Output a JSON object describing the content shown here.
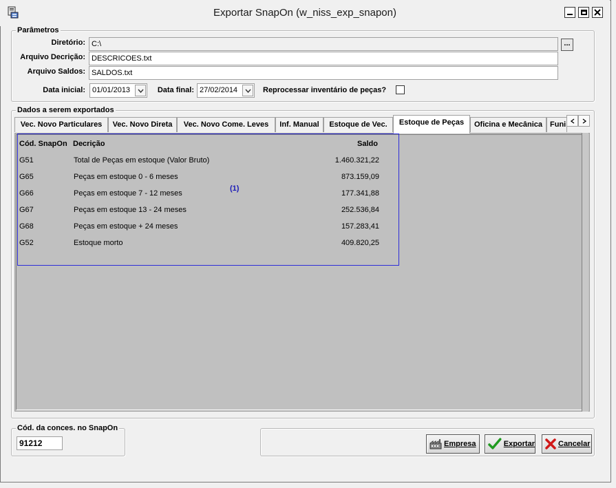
{
  "window": {
    "title": "Exportar SnapOn (w_niss_exp_snapon)"
  },
  "parametros": {
    "group_title": "Parâmetros",
    "diretorio_label": "Diretório:",
    "diretorio_value": "C:\\",
    "browse_label": "...",
    "arquivo_decricao_label": "Arquivo Decrição:",
    "arquivo_decricao_value": "DESCRICOES.txt",
    "arquivo_saldos_label": "Arquivo Saldos:",
    "arquivo_saldos_value": "SALDOS.txt",
    "data_inicial_label": "Data inicial:",
    "data_inicial_value": "01/01/2013",
    "data_final_label": "Data final:",
    "data_final_value": "27/02/2014",
    "reprocessar_label": "Reprocessar inventário de peças?",
    "reprocessar_checked": false
  },
  "dados": {
    "group_title": "Dados a serem exportados",
    "tabs": [
      {
        "label": "Vec. Novo Particulares",
        "active": false
      },
      {
        "label": "Vec. Novo Direta",
        "active": false
      },
      {
        "label": "Vec. Novo Come. Leves",
        "active": false
      },
      {
        "label": "Inf. Manual",
        "active": false
      },
      {
        "label": "Estoque de Vec.",
        "active": false
      },
      {
        "label": "Estoque de Peças",
        "active": true
      },
      {
        "label": "Oficina e Mecânica",
        "active": false
      },
      {
        "label": "Funi",
        "active": false
      }
    ],
    "report": {
      "columns": [
        "Cód. SnapOn",
        "Decrição",
        "Saldo"
      ],
      "marker": "(1)",
      "rows": [
        {
          "code": "G51",
          "desc": "Total de Peças em estoque (Valor Bruto)",
          "saldo": "1.460.321,22"
        },
        {
          "code": "G65",
          "desc": "Peças em estoque 0 - 6 meses",
          "saldo": "873.159,09"
        },
        {
          "code": "G66",
          "desc": "Peças em estoque 7 - 12 meses",
          "saldo": "177.341,88"
        },
        {
          "code": "G67",
          "desc": "Peças em estoque 13 - 24 meses",
          "saldo": "252.536,84"
        },
        {
          "code": "G68",
          "desc": "Peças em estoque + 24 meses",
          "saldo": "157.283,41"
        },
        {
          "code": "G52",
          "desc": "Estoque morto",
          "saldo": "409.820,25"
        }
      ]
    }
  },
  "concessionaria": {
    "group_title": "Cód. da conces. no SnapOn",
    "value": "91212"
  },
  "buttons": {
    "empresa": "Empresa",
    "exportar": "Exportar",
    "cancelar": "Cancelar"
  },
  "colors": {
    "report_border": "#2b2bd8",
    "marker": "#1a1ab8",
    "panel_bg": "#c0c0c0",
    "exportar_icon": "#1f9a1f",
    "cancelar_icon": "#d01818"
  }
}
